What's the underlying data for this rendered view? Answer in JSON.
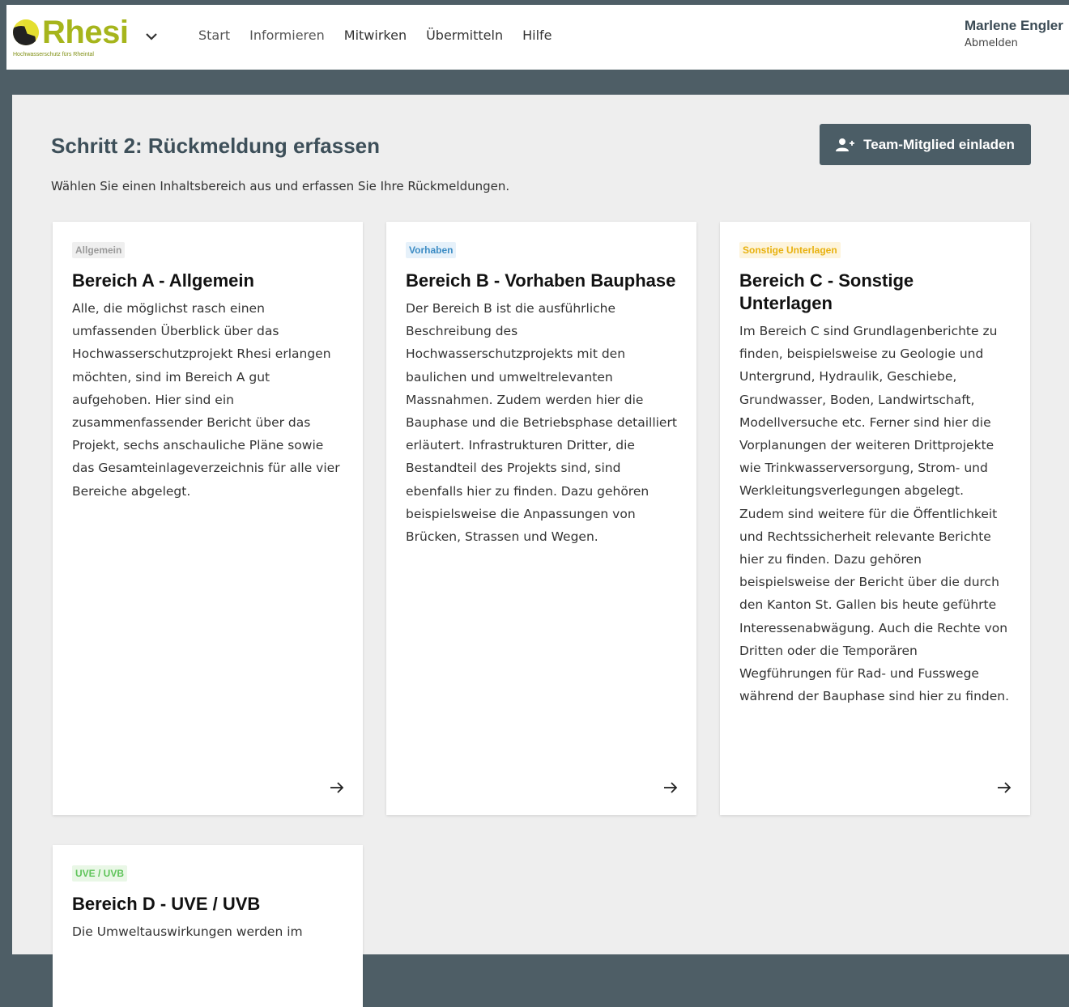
{
  "brand": {
    "name": "Rhesi",
    "tagline": "Hochwasserschutz fürs Rheintal",
    "color": "#a6b51c"
  },
  "nav": {
    "items": [
      {
        "label": "Start"
      },
      {
        "label": "Informieren"
      },
      {
        "label": "Mitwirken"
      },
      {
        "label": "Übermitteln"
      },
      {
        "label": "Hilfe"
      }
    ]
  },
  "user": {
    "name": "Marlene Engler",
    "logout": "Abmelden"
  },
  "page": {
    "title": "Schritt 2: Rückmeldung erfassen",
    "subtitle": "Wählen Sie einen Inhaltsbereich aus und erfassen Sie Ihre Rückmeldungen.",
    "invite_button": "Team-Mitglied einladen"
  },
  "cards": [
    {
      "badge": "Allgemein",
      "badge_color": "#9a9a9a",
      "badge_bg": "#efefef",
      "title": "Bereich A - Allgemein",
      "text": "Alle, die möglichst rasch einen umfassenden Überblick über das Hochwasserschutzprojekt Rhesi erlangen möchten, sind im Bereich A gut aufgehoben. Hier sind ein zusammenfassender Bericht über das Projekt, sechs anschauliche Pläne sowie das Gesamteinlageverzeichnis für alle vier Bereiche abgelegt."
    },
    {
      "badge": "Vorhaben",
      "badge_color": "#3c8cc4",
      "badge_bg": "#e6f1fa",
      "title": "Bereich B - Vorhaben Bauphase",
      "text": "Der Bereich B ist die ausführliche Beschreibung des Hochwasserschutzprojekts mit den baulichen und umweltrelevanten Massnahmen. Zudem werden hier die Bauphase und die Betriebsphase detailliert erläutert. Infrastrukturen Dritter, die Bestandteil des Projekts sind, sind ebenfalls hier zu finden. Dazu gehören beispielsweise die Anpassungen von Brücken, Strassen und Wegen."
    },
    {
      "badge": "Sonstige Unterlagen",
      "badge_color": "#e8b10f",
      "badge_bg": "#fdf4dc",
      "title": "Bereich C - Sonstige Unterlagen",
      "text": "Im Bereich C sind Grundlagenberichte zu finden, beispielsweise zu Geologie und Untergrund, Hydraulik, Geschiebe, Grundwasser, Boden, Landwirtschaft, Modellversuche etc. Ferner sind hier die Vorplanungen der weiteren Drittprojekte wie Trinkwasserversorgung, Strom- und Werkleitungsverlegungen abgelegt. Zudem sind weitere für die Öffentlichkeit und Rechtssicherheit relevante Berichte hier zu finden. Dazu gehören beispielsweise der Bericht über die durch den Kanton St. Gallen bis heute geführte Interessenabwägung. Auch die Rechte von Dritten oder die Temporären Wegführungen für Rad- und Fusswege während der Bauphase sind hier zu finden."
    },
    {
      "badge": "UVE / UVB",
      "badge_color": "#5fc45a",
      "badge_bg": "#e9f7e6",
      "title": "Bereich D - UVE / UVB",
      "text": "Die Umweltauswirkungen werden im"
    }
  ],
  "icons": {
    "card_arrow": "arrow-right-icon",
    "invite": "user-plus-icon",
    "brand_menu": "chevron-down-icon"
  }
}
